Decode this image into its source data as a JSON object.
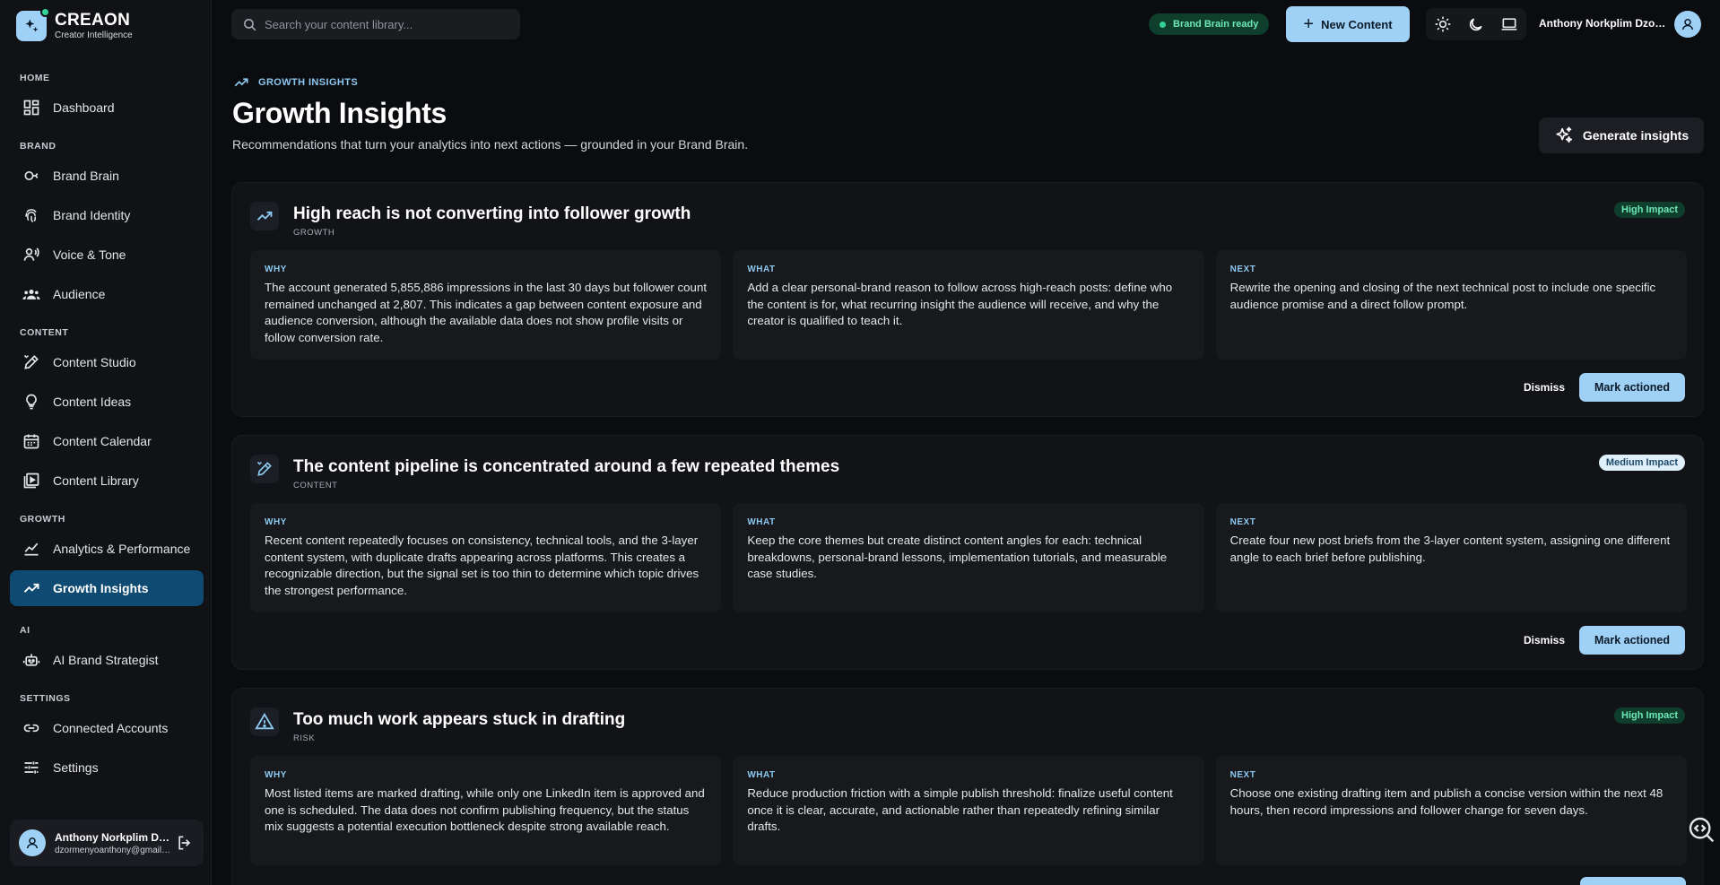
{
  "app": {
    "name": "CREAON",
    "tagline": "Creator Intelligence"
  },
  "sidebar": {
    "sections": [
      {
        "label": "HOME",
        "items": [
          {
            "label": "Dashboard",
            "icon": "dashboard-icon"
          }
        ]
      },
      {
        "label": "BRAND",
        "items": [
          {
            "label": "Brand Brain",
            "icon": "brain-icon"
          },
          {
            "label": "Brand Identity",
            "icon": "fingerprint-icon"
          },
          {
            "label": "Voice & Tone",
            "icon": "voice-icon"
          },
          {
            "label": "Audience",
            "icon": "group-icon"
          }
        ]
      },
      {
        "label": "CONTENT",
        "items": [
          {
            "label": "Content Studio",
            "icon": "edit-icon"
          },
          {
            "label": "Content Ideas",
            "icon": "lightbulb-icon"
          },
          {
            "label": "Content Calendar",
            "icon": "calendar-icon"
          },
          {
            "label": "Content Library",
            "icon": "library-icon"
          }
        ]
      },
      {
        "label": "GROWTH",
        "items": [
          {
            "label": "Analytics & Performance",
            "icon": "analytics-icon"
          },
          {
            "label": "Growth Insights",
            "icon": "trending-icon",
            "active": true
          }
        ]
      },
      {
        "label": "AI",
        "items": [
          {
            "label": "AI Brand Strategist",
            "icon": "robot-icon"
          }
        ]
      },
      {
        "label": "SETTINGS",
        "items": [
          {
            "label": "Connected Accounts",
            "icon": "link-icon"
          },
          {
            "label": "Settings",
            "icon": "sliders-icon"
          }
        ]
      }
    ],
    "user": {
      "name": "Anthony Norkplim Dzormenyo",
      "email": "dzormenyoanthony@gmail.com"
    }
  },
  "header": {
    "search_placeholder": "Search your content library...",
    "status_badge": "Brand Brain ready",
    "new_content_label": "New Content",
    "user_name": "Anthony Norkplim Dzormenyo"
  },
  "page": {
    "eyebrow": "GROWTH INSIGHTS",
    "title": "Growth Insights",
    "subtitle": "Recommendations that turn your analytics into next actions — grounded in your Brand Brain.",
    "generate_label": "Generate insights"
  },
  "labels": {
    "why": "WHY",
    "what": "WHAT",
    "next": "NEXT",
    "dismiss": "Dismiss",
    "mark_actioned": "Mark actioned"
  },
  "insights": [
    {
      "title": "High reach is not converting into follower growth",
      "category": "GROWTH",
      "impact": "High Impact",
      "impact_level": "high",
      "icon": "trending-up-icon",
      "why": "The account generated 5,855,886 impressions in the last 30 days but follower count remained unchanged at 2,807. This indicates a gap between content exposure and audience conversion, although the available data does not show profile visits or follow conversion rate.",
      "what": "Add a clear personal-brand reason to follow across high-reach posts: define who the content is for, what recurring insight the audience will receive, and why the creator is qualified to teach it.",
      "next": "Rewrite the opening and closing of the next technical post to include one specific audience promise and a direct follow prompt."
    },
    {
      "title": "The content pipeline is concentrated around a few repeated themes",
      "category": "CONTENT",
      "impact": "Medium Impact",
      "impact_level": "medium",
      "icon": "pen-icon",
      "why": "Recent content repeatedly focuses on consistency, technical tools, and the 3-layer content system, with duplicate drafts appearing across platforms. This creates a recognizable direction, but the signal set is too thin to determine which topic drives the strongest performance.",
      "what": "Keep the core themes but create distinct content angles for each: technical breakdowns, personal-brand lessons, implementation tutorials, and measurable case studies.",
      "next": "Create four new post briefs from the 3-layer content system, assigning one different angle to each brief before publishing."
    },
    {
      "title": "Too much work appears stuck in drafting",
      "category": "RISK",
      "impact": "High Impact",
      "impact_level": "high",
      "icon": "warning-icon",
      "why": "Most listed items are marked drafting, while only one LinkedIn item is approved and one is scheduled. The data does not confirm publishing frequency, but the status mix suggests a potential execution bottleneck despite strong available reach.",
      "what": "Reduce production friction with a simple publish threshold: finalize useful content once it is clear, accurate, and actionable rather than repeatedly refining similar drafts.",
      "next": "Choose one existing drafting item and publish a concise version within the next 48 hours, then record impressions and follower change for seven days."
    }
  ],
  "colors": {
    "accent": "#9fd0f5",
    "active_nav": "#0f4a72",
    "success": "#34d399",
    "background": "#0b0c0f"
  }
}
